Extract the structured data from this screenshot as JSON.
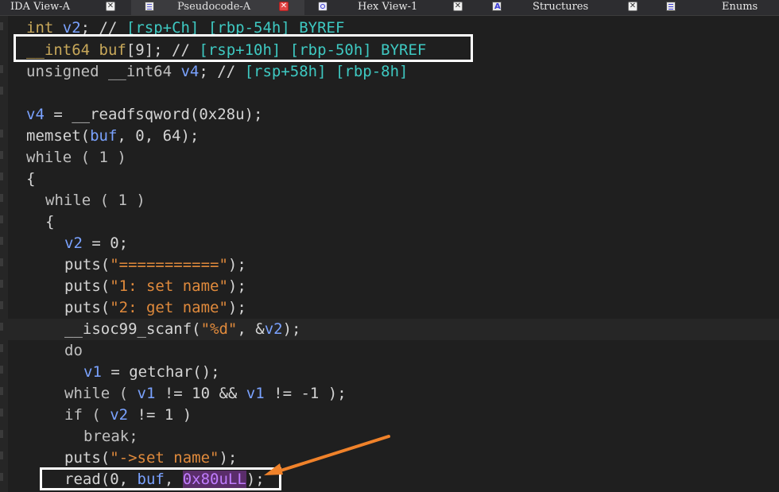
{
  "tabs": [
    {
      "label": "IDA View-A",
      "icon": "ida-view-icon",
      "active": false
    },
    {
      "label": "Pseudocode-A",
      "icon": "pseudocode-icon",
      "active": true
    },
    {
      "label": "Hex View-1",
      "icon": "hex-view-icon",
      "active": false
    },
    {
      "label": "Structures",
      "icon": "structures-icon",
      "active": false
    },
    {
      "label": "Enums",
      "icon": "enums-icon",
      "active": false
    }
  ],
  "code": {
    "l0": [
      "int",
      " ",
      "v2",
      "; // ",
      "[rsp+Ch] [rbp-54h] BYREF"
    ],
    "l1": [
      "__int64",
      " ",
      "buf",
      "[9]; // ",
      "[rsp+10h] [rbp-50h] BYREF"
    ],
    "l2": [
      "unsigned __int64",
      " ",
      "v4",
      "; // ",
      "[rsp+58h] [rbp-8h]"
    ],
    "l4": [
      "v4",
      " = __readfsqword(0x28u);"
    ],
    "l5": [
      "memset(",
      "buf",
      ", 0, 64);"
    ],
    "l6": [
      "while ( 1 )"
    ],
    "l7": [
      "{"
    ],
    "l8": [
      "while ( 1 )"
    ],
    "l9": [
      "{"
    ],
    "l10": [
      "v2",
      " = 0;"
    ],
    "l11": [
      "puts(",
      "\"===========\"",
      ");"
    ],
    "l12": [
      "puts(",
      "\"1: set name\"",
      ");"
    ],
    "l13": [
      "puts(",
      "\"2: get name\"",
      ");"
    ],
    "l14": [
      "__isoc99_scanf(",
      "\"%d\"",
      ", &",
      "v2",
      ");"
    ],
    "l15": [
      "do"
    ],
    "l16": [
      "v1",
      " = getchar();"
    ],
    "l17": [
      "while ( ",
      "v1",
      " != 10 && ",
      "v1",
      " != -1 );"
    ],
    "l18": [
      "if ( ",
      "v2",
      " != 1 )"
    ],
    "l19": [
      "break;"
    ],
    "l20": [
      "puts(",
      "\"->set name\"",
      ");"
    ],
    "l21": [
      "read(0, ",
      "buf",
      ", ",
      "0x80uLL",
      ");"
    ]
  },
  "colors": {
    "highlight_box": "#ffffff",
    "arrow": "#f0822a",
    "comment": "#3ec9c2",
    "string": "#e08a3c",
    "variable": "#7aa2ff",
    "type": "#c8a85a"
  }
}
